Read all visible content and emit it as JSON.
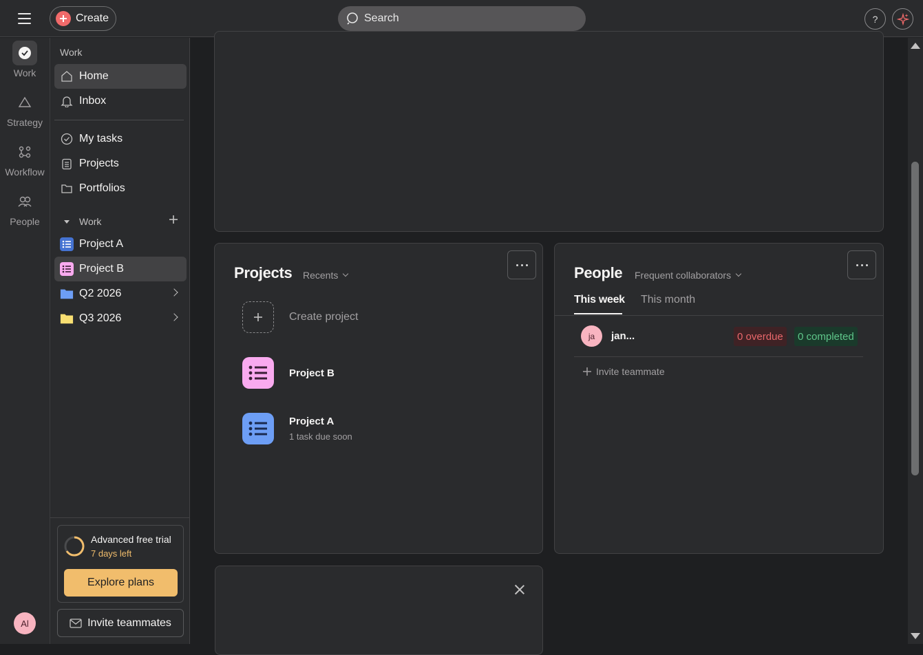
{
  "topbar": {
    "create_label": "Create",
    "search_placeholder": "Search",
    "help_label": "?"
  },
  "rail": {
    "items": [
      {
        "label": "Work",
        "icon": "check-circle-icon"
      },
      {
        "label": "Strategy",
        "icon": "triangle-icon"
      },
      {
        "label": "Workflow",
        "icon": "workflow-icon"
      },
      {
        "label": "People",
        "icon": "people-icon"
      }
    ],
    "avatar_initials": "Al"
  },
  "sidebar": {
    "section_work": "Work",
    "items": [
      {
        "label": "Home",
        "icon": "home-icon"
      },
      {
        "label": "Inbox",
        "icon": "bell-icon"
      },
      {
        "label": "My tasks",
        "icon": "check-circle-icon"
      },
      {
        "label": "Projects",
        "icon": "clipboard-icon"
      },
      {
        "label": "Portfolios",
        "icon": "folder-icon"
      }
    ],
    "team_section": "Work",
    "team_items": [
      {
        "label": "Project A",
        "color": "#4573d2"
      },
      {
        "label": "Project B",
        "color": "#f9aaef"
      },
      {
        "label": "Q2 2026",
        "color": "#6d9ef5"
      },
      {
        "label": "Q3 2026",
        "color": "#f8df72"
      }
    ],
    "trial_title": "Advanced free trial",
    "trial_days": "7 days left",
    "explore_label": "Explore plans",
    "invite_label": "Invite teammates"
  },
  "projects_card": {
    "title": "Projects",
    "filter": "Recents",
    "create_label": "Create project",
    "items": [
      {
        "name": "Project B",
        "sub": "",
        "color": "#f9aaef"
      },
      {
        "name": "Project A",
        "sub": "1 task due soon",
        "color": "#6d9ef5"
      }
    ]
  },
  "people_card": {
    "title": "People",
    "filter": "Frequent collaborators",
    "tabs": [
      "This week",
      "This month"
    ],
    "person": {
      "initials": "ja",
      "name": "jan...",
      "overdue": "0 overdue",
      "completed": "0 completed"
    },
    "invite_label": "Invite teammate"
  },
  "colors": {
    "accent": "#f06a6a",
    "trial": "#f1bd6c"
  }
}
